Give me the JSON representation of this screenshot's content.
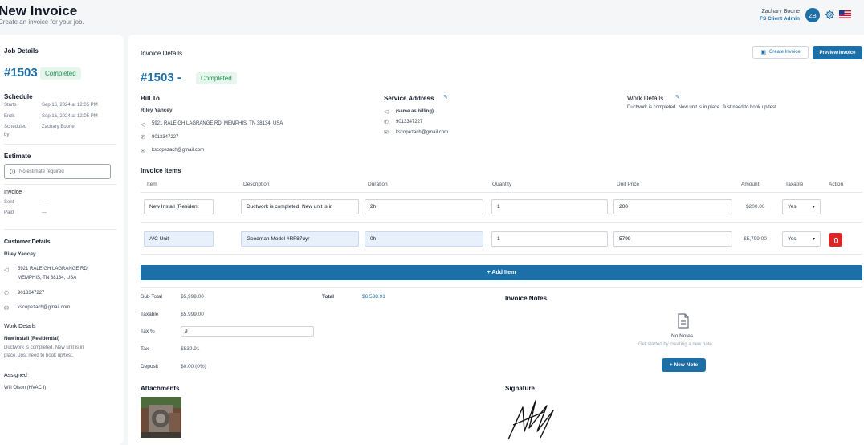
{
  "header": {
    "title": "New Invoice",
    "subtitle": "Create an invoice for your job."
  },
  "user": {
    "name": "Zachary Boone",
    "role": "FS Client Admin",
    "initials": "ZB",
    "icons": [
      "settings-icon",
      "us-flag-icon"
    ]
  },
  "sidebar": {
    "job_details_label": "Job Details",
    "job_number": "#1503",
    "status": "Completed",
    "schedule_label": "Schedule",
    "starts_label": "Starts",
    "starts_value": "Sep 16, 2024 at 12:05 PM",
    "ends_label": "Ends",
    "ends_value": "Sep 16, 2024 at 12:05 PM",
    "scheduled_by_label_1": "Scheduled",
    "scheduled_by_label_2": "by",
    "scheduled_by_value": "Zachary Boone",
    "estimate_label": "Estimate",
    "estimate_value": "No estimate required",
    "invoice_label": "Invoice",
    "sent_label": "Sent",
    "sent_value": "---",
    "paid_label": "Paid",
    "paid_value": "---",
    "customer_details_label": "Customer Details",
    "customer_name": "Riley Yancey",
    "customer_address_1": "5921 RALEIGH LAGRANGE RD,",
    "customer_address_2": "MEMPHIS, TN 38134, USA",
    "customer_phone": "9013347227",
    "customer_email": "kscopezach@gmail.com",
    "work_details_label": "Work Details",
    "work_title": "New Install (Residential)",
    "work_desc_1": "Ductwork is completed. New unit is in",
    "work_desc_2": "place. Just need to hook up/test.",
    "assigned_label": "Assigned",
    "assigned_value": "Will Olson (HVAC I)"
  },
  "invoice": {
    "section_title": "Invoice Details",
    "create_invoice_label": "Create Invoice",
    "preview_invoice_label": "Preview Invoice",
    "job_number": "#1503 -",
    "status": "Completed",
    "bill_to_label": "Bill To",
    "bill_to_name": "Riley Yancey",
    "bill_to_address": "5921 RALEIGH LAGRANGE RD, MEMPHIS, TN 38134, USA",
    "bill_to_phone": "9013347227",
    "bill_to_email": "kscopezach@gmail.com",
    "service_address_label": "Service Address",
    "service_address": "(same as billing)",
    "service_phone": "9013347227",
    "service_email": "kscopezach@gmail.com",
    "work_details_label": "Work Details",
    "work_details_text": "Ductwork is completed. New unit is in place. Just need to hook up/test",
    "items_label": "Invoice Items",
    "columns": [
      "Item",
      "Description",
      "Duration",
      "Quantity",
      "Unit Price",
      "Amount",
      "Taxable",
      "Action"
    ],
    "items": [
      {
        "item": "New Install (Resident",
        "description": "Ductwork is completed. New unit is ir",
        "duration": "2h",
        "quantity": "1",
        "unit_price": "200",
        "amount": "$200.00",
        "taxable": "Yes"
      },
      {
        "item": "A/C Unit",
        "description": "Goodman Model #RF87uyr",
        "duration": "0h",
        "quantity": "1",
        "unit_price": "5799",
        "amount": "$5,799.00",
        "taxable": "Yes"
      }
    ],
    "add_item_label": "+ Add Item",
    "totals": {
      "sub_total_label": "Sub Total",
      "sub_total": "$5,999.00",
      "taxable_label": "Taxable",
      "taxable": "$5,999.00",
      "tax_pct_label": "Tax %",
      "tax_pct": "9",
      "tax_label": "Tax",
      "tax": "$539.91",
      "deposit_label": "Deposit",
      "deposit": "$0.00 (0%)",
      "total_label": "Total",
      "total": "$6,538.91"
    },
    "notes_label": "Invoice Notes",
    "no_notes": "No Notes",
    "notes_hint": "Get started by creating a new note.",
    "new_note_label": "+ New Note",
    "attachments_label": "Attachments",
    "signature_label": "Signature"
  }
}
